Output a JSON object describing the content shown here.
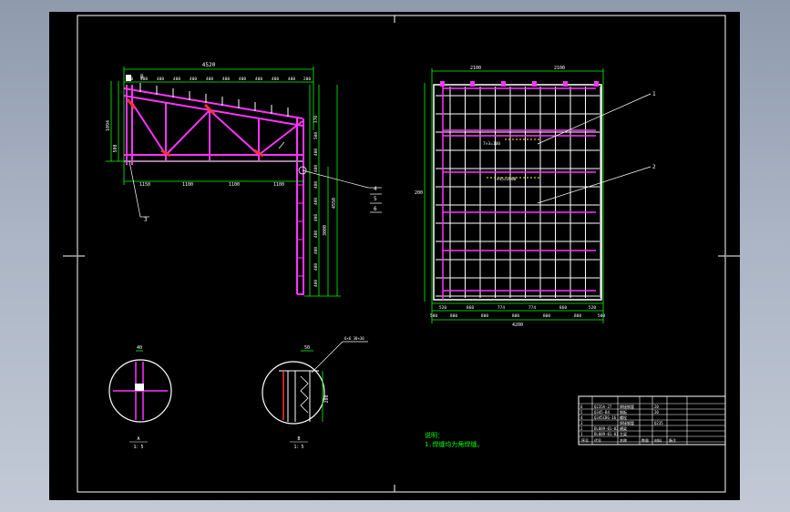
{
  "colors": {
    "background": "#000000",
    "frame": "#ffffff",
    "member": "#ff33ff",
    "dimension": "#00ff00",
    "label": "#ffffff",
    "note": "#00ff00",
    "hatch": "#ff3333",
    "accent": "#ffff00"
  },
  "elevation": {
    "overall_width": "4520",
    "top_dims": [
      "180",
      "400",
      "400",
      "400",
      "400",
      "400",
      "400",
      "400",
      "400",
      "400",
      "400",
      "200"
    ],
    "bottom_dims": [
      "1150",
      "1100",
      "1100",
      "1100"
    ],
    "left_heights": [
      "1094",
      "500"
    ],
    "right_heights": [
      "370",
      "500",
      "400",
      "400",
      "400",
      "400",
      "400",
      "400",
      "400",
      "400",
      "400"
    ],
    "right_totals": [
      "3000",
      "4550"
    ],
    "section_mark": "B",
    "leader_labels": [
      "4",
      "5",
      "6",
      "3"
    ]
  },
  "plan": {
    "top_dims": [
      "2100",
      "2100"
    ],
    "bottom_dims": [
      "500",
      "800",
      "800",
      "800",
      "800",
      "800",
      "500"
    ],
    "bottom_sub": [
      "520",
      "860",
      "774",
      "774",
      "860",
      "520"
    ],
    "bottom_total": "4200",
    "left_dim": "200",
    "callout_a": "7×3=100",
    "callout_b": "1×45=1000",
    "leader_labels": [
      "1",
      "2"
    ]
  },
  "details": {
    "a": {
      "label": "A",
      "scale": "1：5",
      "dim": "40"
    },
    "b": {
      "label": "B",
      "scale": "1：5",
      "dims": [
        "50",
        "200"
      ],
      "note": "6×6 30×30"
    }
  },
  "notes": {
    "title": "说明：",
    "line1": "1.焊缝均为角焊缝。"
  },
  "title_block": {
    "rows": [
      [
        "6",
        "Q235A-27",
        "焊接钢管",
        "",
        "20",
        ""
      ],
      [
        "5",
        "Q345-B4",
        "钢板",
        "",
        "20",
        ""
      ],
      [
        "4",
        "Q345CBG-16",
        "螺栓",
        "",
        "",
        ""
      ],
      [
        "3",
        "",
        "焊接钢管",
        "",
        "Q235",
        ""
      ],
      [
        "2",
        "DL009-01-02",
        "横梁",
        "",
        "",
        ""
      ],
      [
        "1",
        "DL009-01-01",
        "主梁",
        "",
        "",
        ""
      ]
    ],
    "header": [
      "序号",
      "代号",
      "名称",
      "数量",
      "材料",
      "备注"
    ]
  }
}
